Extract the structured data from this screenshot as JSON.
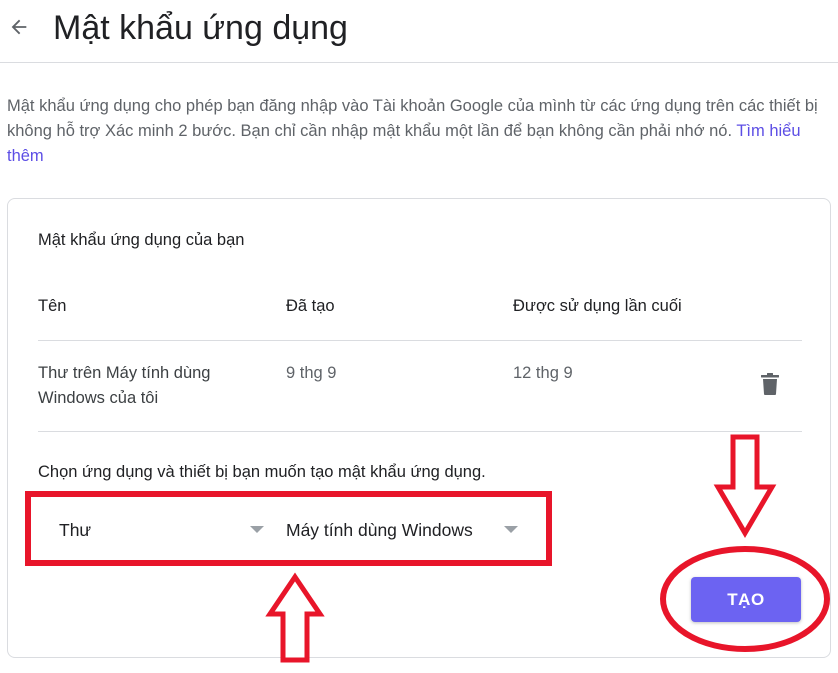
{
  "header": {
    "title": "Mật khẩu ứng dụng",
    "back_icon": "arrow-left-icon"
  },
  "description": {
    "text": "Mật khẩu ứng dụng cho phép bạn đăng nhập vào Tài khoản Google của mình từ các ứng dụng trên các thiết bị không hỗ trợ Xác minh 2 bước. Bạn chỉ cần nhập mật khẩu một lần để bạn không cần phải nhớ nó. ",
    "link_label": "Tìm hiểu thêm"
  },
  "card": {
    "title": "Mật khẩu ứng dụng của bạn",
    "columns": [
      "Tên",
      "Đã tạo",
      "Được sử dụng lần cuối"
    ],
    "rows": [
      {
        "name": "Thư trên Máy tính dùng Windows của tôi",
        "created": "9 thg 9",
        "last_used": "12 thg 9",
        "delete_icon": "trash-icon"
      }
    ],
    "instruction": "Chọn ứng dụng và thiết bị bạn muốn tạo mật khẩu ứng dụng.",
    "app_select": {
      "value": "Thư"
    },
    "device_select": {
      "value": "Máy tính dùng Windows"
    },
    "create_label": "TẠO"
  },
  "colors": {
    "accent": "#6c63f2",
    "link": "#5c4ee5",
    "annotation": "#e8152a",
    "text": "#202124",
    "muted": "#5f6368"
  }
}
